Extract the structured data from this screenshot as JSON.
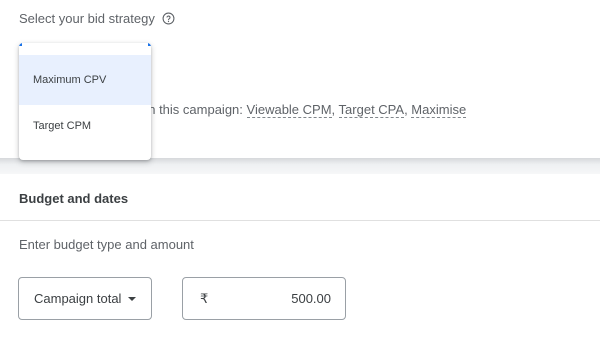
{
  "bid_strategy": {
    "label": "Select your bid strategy",
    "help_icon": "help-circle-icon",
    "menu": {
      "items": [
        {
          "label": "Maximum CPV",
          "selected": true
        },
        {
          "label": "Target CPM",
          "selected": false
        }
      ]
    },
    "unavailable": {
      "text_visible": "egies aren't available in this campaign: ",
      "strategies": [
        "Viewable CPM",
        "Target CPA",
        "Maximise"
      ],
      "separator": ", "
    }
  },
  "budget": {
    "section_title": "Budget and dates",
    "hint": "Enter budget type and amount",
    "type_select": {
      "value": "Campaign total",
      "icon": "arrow-drop-down-icon"
    },
    "amount": {
      "currency_symbol": "₹",
      "value": "500.00"
    }
  },
  "colors": {
    "accent": "#1a73e8",
    "selected_bg": "#e8f0fe",
    "text": "#3c4043",
    "muted_text": "#5f6368"
  }
}
